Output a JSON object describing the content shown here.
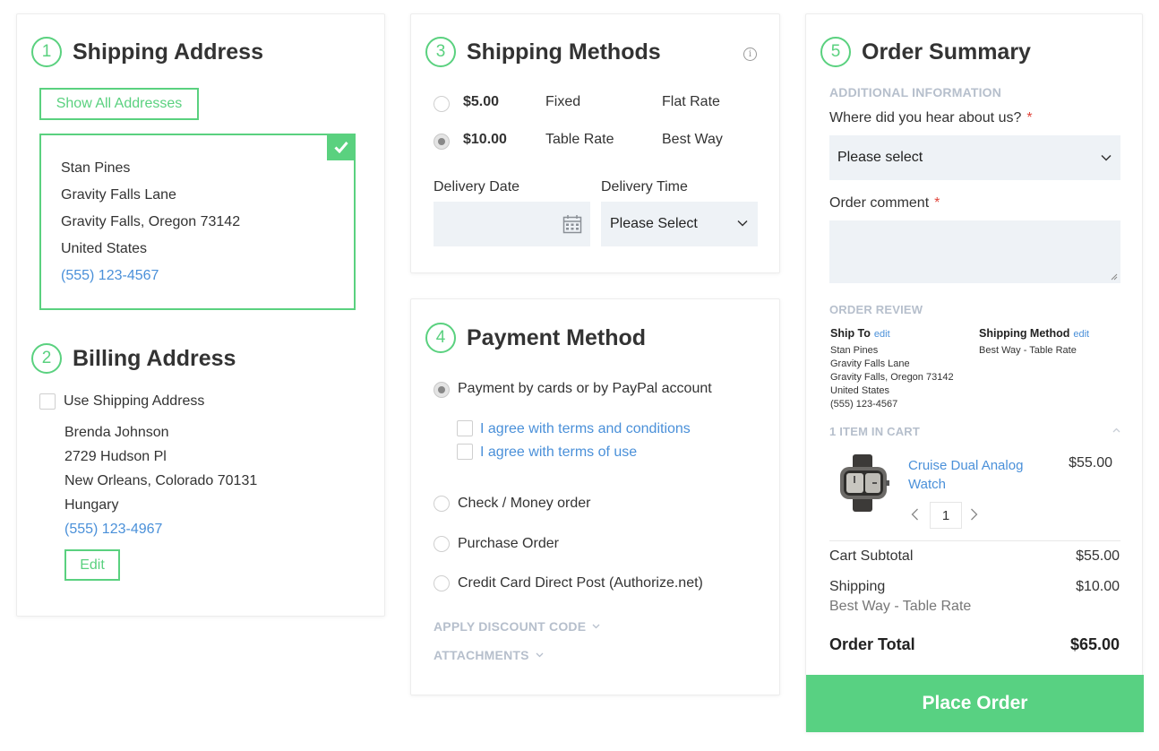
{
  "shipping_address": {
    "step": "1",
    "title": "Shipping Address",
    "show_all_label": "Show All Addresses",
    "name": "Stan Pines",
    "street": "Gravity Falls Lane",
    "city_line": "Gravity Falls, Oregon 73142",
    "country": "United States",
    "phone": "(555) 123-4567"
  },
  "billing_address": {
    "step": "2",
    "title": "Billing Address",
    "use_shipping_label": "Use Shipping Address",
    "name": "Brenda Johnson",
    "street": "2729 Hudson Pl",
    "city_line": "New Orleans, Colorado 70131",
    "country": "Hungary",
    "phone": "(555) 123-4967",
    "edit_label": "Edit"
  },
  "shipping_methods": {
    "step": "3",
    "title": "Shipping Methods",
    "options": [
      {
        "price": "$5.00",
        "method": "Fixed",
        "carrier": "Flat Rate",
        "selected": false
      },
      {
        "price": "$10.00",
        "method": "Table Rate",
        "carrier": "Best Way",
        "selected": true
      }
    ],
    "delivery_date_label": "Delivery Date",
    "delivery_date_value": "",
    "delivery_time_label": "Delivery Time",
    "delivery_time_value": "Please Select"
  },
  "payment_method": {
    "step": "4",
    "title": "Payment Method",
    "options": [
      "Payment by cards or by PayPal account",
      "Check / Money order",
      "Purchase Order",
      "Credit Card Direct Post (Authorize.net)"
    ],
    "agree_terms_conditions": "I agree with terms and conditions",
    "agree_terms_use": "I agree with terms of use",
    "discount_label": "APPLY DISCOUNT CODE",
    "attachments_label": "ATTACHMENTS"
  },
  "order_summary": {
    "step": "5",
    "title": "Order Summary",
    "additional_info_label": "ADDITIONAL INFORMATION",
    "hear_about_label": "Where did you hear about us?",
    "hear_about_value": "Please select",
    "comment_label": "Order comment",
    "comment_value": "",
    "required_mark": "*",
    "order_review_label": "ORDER REVIEW",
    "ship_to_label": "Ship To",
    "shipping_method_label": "Shipping Method",
    "edit_link": "edit",
    "ship_to_lines": [
      "Stan Pines",
      "Gravity Falls Lane",
      "Gravity Falls, Oregon 73142",
      "United States"
    ],
    "ship_to_phone": "(555) 123-4567",
    "shipping_method_value": "Best Way - Table Rate",
    "items_in_cart_label": "1 ITEM IN CART",
    "item_name": "Cruise Dual Analog Watch",
    "item_price": "$55.00",
    "item_qty": "1",
    "subtotal_label": "Cart Subtotal",
    "subtotal_value": "$55.00",
    "shipping_label": "Shipping",
    "shipping_value": "$10.00",
    "shipping_desc": "Best Way - Table Rate",
    "total_label": "Order Total",
    "total_value": "$65.00",
    "place_order_label": "Place Order"
  },
  "colors": {
    "accent": "#5ad17f",
    "link": "#4a90d9",
    "field_bg": "#eef2f6",
    "muted_label": "#b6bfcc",
    "required": "#e0453b"
  }
}
